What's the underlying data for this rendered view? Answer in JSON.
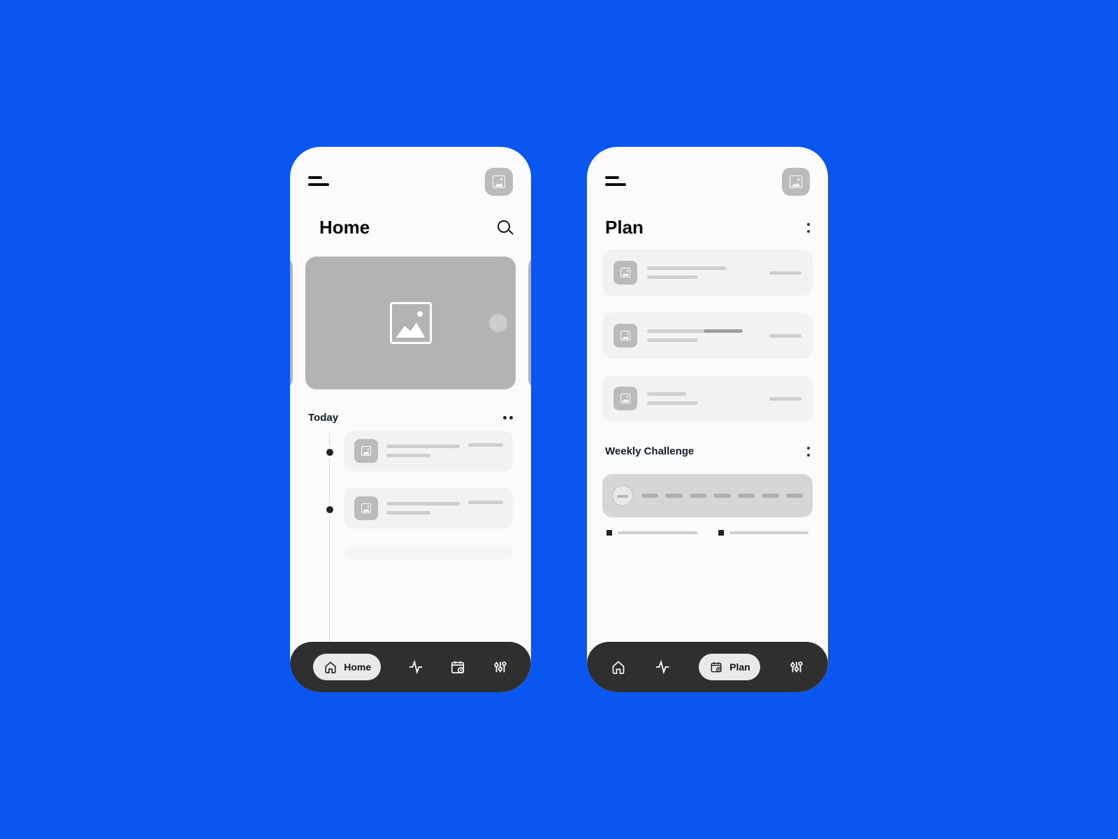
{
  "screens": {
    "home": {
      "title": "Home",
      "section_today": "Today",
      "nav": {
        "home": "Home",
        "activity": "Activity",
        "plan": "Plan",
        "settings": "Settings"
      }
    },
    "plan": {
      "title": "Plan",
      "section_weekly": "Weekly Challenge",
      "nav": {
        "home": "Home",
        "activity": "Activity",
        "plan": "Plan",
        "settings": "Settings"
      }
    }
  }
}
